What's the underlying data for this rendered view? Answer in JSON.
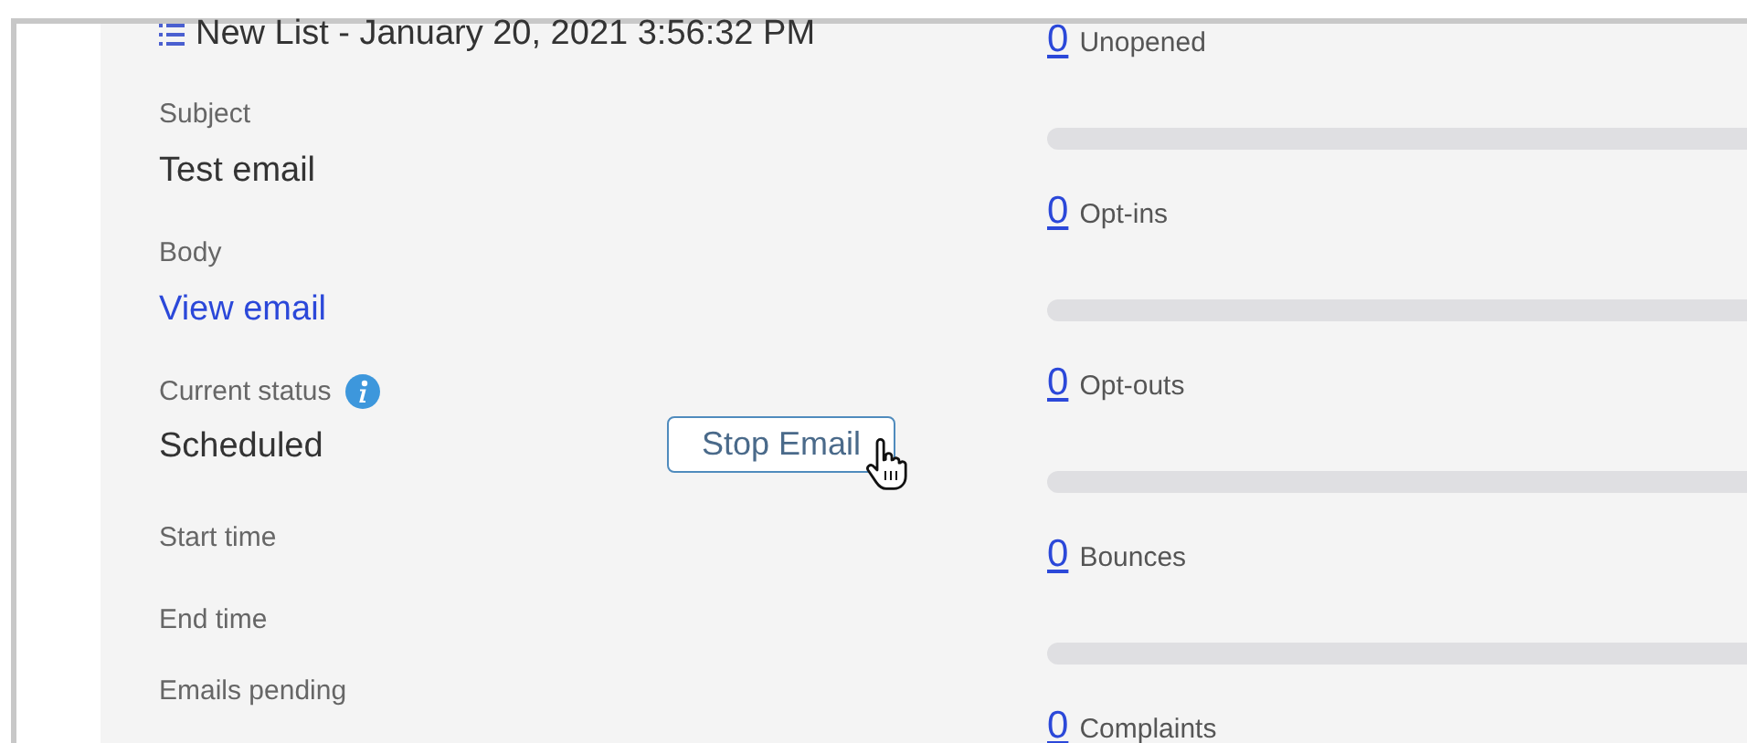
{
  "list_name": "New List - January 20, 2021 3:56:32 PM",
  "fields": [
    {
      "label": "Subject",
      "kind": "text",
      "value": "Test email"
    },
    {
      "label": "Body",
      "kind": "link",
      "value": "View email"
    },
    {
      "label": "Current status",
      "kind": "status",
      "value": "Scheduled",
      "action": "Stop Email"
    },
    {
      "label": "Start time",
      "kind": "empty"
    },
    {
      "label": "End time",
      "kind": "empty"
    },
    {
      "label": "Emails pending",
      "kind": "empty"
    }
  ],
  "stats": [
    {
      "count": "0",
      "label": "Unopened",
      "level": 0
    },
    {
      "count": "0",
      "label": "Opt-ins",
      "level": 0
    },
    {
      "count": "0",
      "label": "Opt-outs",
      "level": 0
    },
    {
      "count": "0",
      "label": "Bounces",
      "level": 0
    },
    {
      "count": "0",
      "label": "Complaints"
    }
  ]
}
